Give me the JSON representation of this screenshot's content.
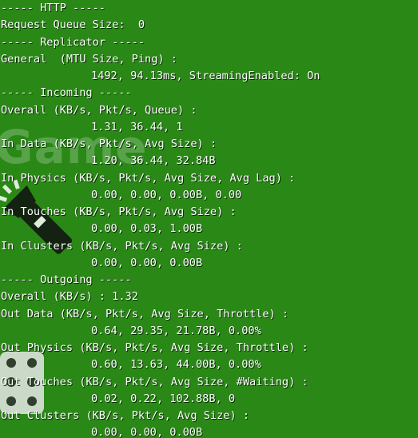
{
  "stats": {
    "http_header": "----- HTTP -----",
    "request_queue": "Request Queue Size:  0",
    "replicator_header": "----- Replicator -----",
    "general_label": "General  (MTU Size, Ping) :",
    "general_value": "1492, 94.13ms, StreamingEnabled: On",
    "incoming_header": "----- Incoming -----",
    "overall_in_label": "Overall (KB/s, Pkt/s, Queue) :",
    "overall_in_value": "1.31, 36.44, 1",
    "in_data_label": "In Data (KB/s, Pkt/s, Avg Size) :",
    "in_data_value": "1.20, 36.44, 32.84B",
    "in_physics_label": "In Physics (KB/s, Pkt/s, Avg Size, Avg Lag) :",
    "in_physics_value": "0.00, 0.00, 0.00B, 0.00",
    "in_touches_label": "In Touches (KB/s, Pkt/s, Avg Size) :",
    "in_touches_value": "0.00, 0.03, 1.00B",
    "in_clusters_label": "In Clusters (KB/s, Pkt/s, Avg Size) :",
    "in_clusters_value": "0.00, 0.00, 0.00B",
    "outgoing_header": "----- Outgoing -----",
    "overall_out": "Overall (KB/s) : 1.32",
    "out_data_label": "Out Data (KB/s, Pkt/s, Avg Size, Throttle) :",
    "out_data_value": "0.64, 29.35, 21.78B, 0.00%",
    "out_physics_label": "Out Physics (KB/s, Pkt/s, Avg Size, Throttle) :",
    "out_physics_value": "0.60, 13.63, 44.00B, 0.00%",
    "out_touches_label": "Out Touches (KB/s, Pkt/s, Avg Size, #Waiting) :",
    "out_touches_value": "0.02, 0.22, 102.88B, 0",
    "out_clusters_label": "Out Clusters (KB/s, Pkt/s, Avg Size) :",
    "out_clusters_value": "0.00, 0.00, 0.00B"
  },
  "background": {
    "icons": [
      "flashlight-icon",
      "dice-icon"
    ],
    "colors": {
      "game_background": "#2a8816",
      "text": "#ffffff"
    }
  }
}
